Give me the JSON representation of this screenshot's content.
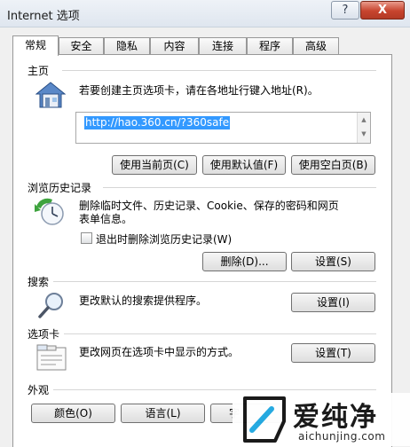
{
  "window": {
    "title": "Internet 选项",
    "help_label": "?",
    "close_label": "X"
  },
  "tabs": [
    {
      "label": "常规",
      "active": true
    },
    {
      "label": "安全"
    },
    {
      "label": "隐私"
    },
    {
      "label": "内容"
    },
    {
      "label": "连接"
    },
    {
      "label": "程序"
    },
    {
      "label": "高级"
    }
  ],
  "home": {
    "title": "主页",
    "description": "若要创建主页选项卡，请在各地址行键入地址(R)。",
    "url": "http://hao.360.cn/?360safe",
    "buttons": {
      "use_current": "使用当前页(C)",
      "use_default": "使用默认值(F)",
      "use_blank": "使用空白页(B)"
    }
  },
  "history": {
    "title": "浏览历史记录",
    "description_line1": "删除临时文件、历史记录、Cookie、保存的密码和网页",
    "description_line2": "表单信息。",
    "checkbox_label": "退出时删除浏览历史记录(W)",
    "delete_button": "删除(D)...",
    "settings_button": "设置(S)"
  },
  "search": {
    "title": "搜索",
    "description": "更改默认的搜索提供程序。",
    "settings_button": "设置(I)"
  },
  "tabs_section": {
    "title": "选项卡",
    "description": "更改网页在选项卡中显示的方式。",
    "settings_button": "设置(T)"
  },
  "appearance": {
    "title": "外观",
    "colors_button": "颜色(O)",
    "languages_button": "语言(L)",
    "fonts_button": "字"
  },
  "watermark": {
    "brand": "爱纯净",
    "site": "aichunjing.com"
  },
  "colors": {
    "selection": "#3399ff",
    "close_button": "#c7442e"
  }
}
